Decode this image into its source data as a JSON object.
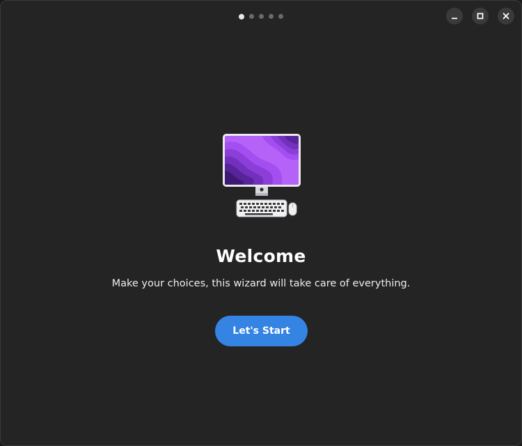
{
  "pager": {
    "total_pages": 5,
    "current_page": 1
  },
  "window_controls": {
    "minimize_icon": "minimize-icon",
    "maximize_icon": "maximize-icon",
    "close_icon": "close-icon"
  },
  "welcome": {
    "illustration_icon": "computer-illustration-icon",
    "title": "Welcome",
    "subtitle": "Make your choices, this wizard will take care of everything.",
    "start_button_label": "Let's Start"
  },
  "colors": {
    "window_bg": "#242424",
    "accent": "#3584e4",
    "screen_purple": "#a855f7"
  }
}
